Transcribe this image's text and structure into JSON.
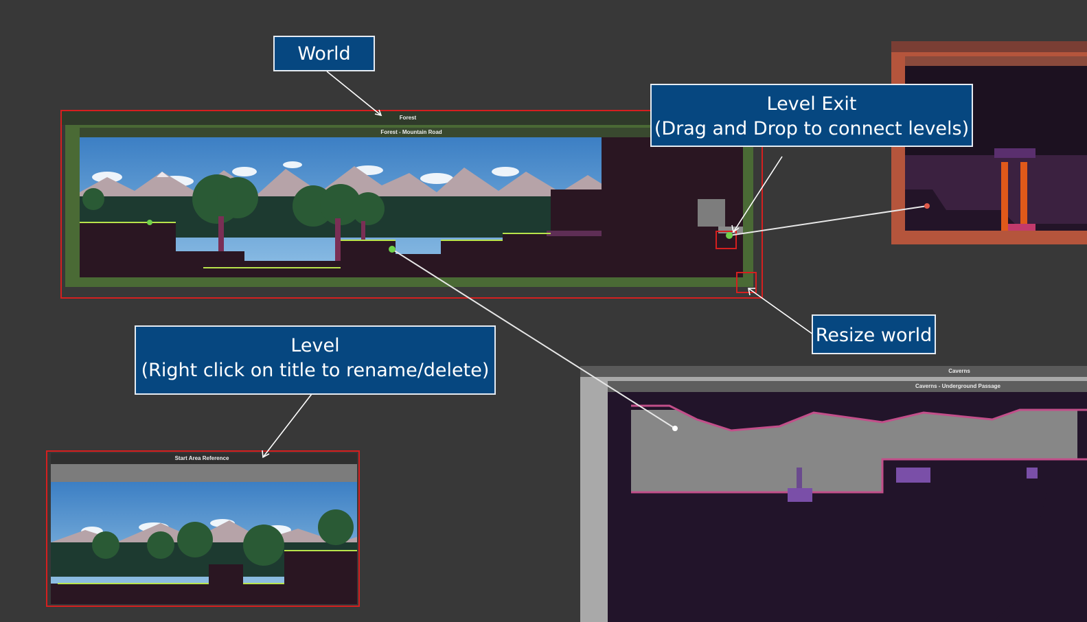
{
  "callouts": {
    "world": {
      "label": "World"
    },
    "level_exit": {
      "line1": "Level Exit",
      "line2": "(Drag and Drop to connect levels)"
    },
    "resize": {
      "label": "Resize world"
    },
    "level": {
      "line1": "Level",
      "line2": "(Right click on title to rename/delete)"
    }
  },
  "worlds": {
    "forest": {
      "title": "Forest",
      "level_title": "Forest - Mountain Road",
      "color": "#4a6a35"
    },
    "caverns": {
      "title": "Caverns",
      "level_title": "Caverns - Underground Passage",
      "color": "#a9a9a9"
    },
    "red_world": {
      "color": "#b5553c"
    }
  },
  "start_area": {
    "title": "Start Area Reference"
  },
  "colors": {
    "annotation_box": "#d61f1f",
    "callout_bg": "#064780",
    "exit_point": "#6fd14a"
  }
}
